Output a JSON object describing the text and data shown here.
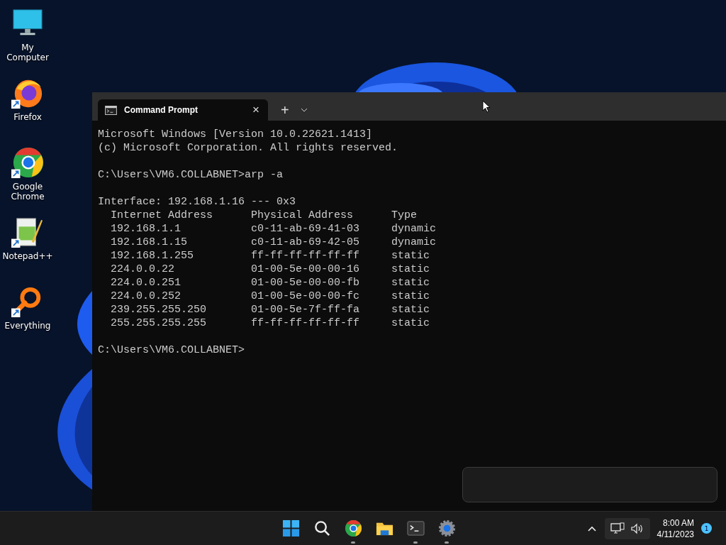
{
  "desktop_icons": [
    {
      "kind": "computer",
      "label": "My Computer",
      "shortcut": false
    },
    {
      "kind": "firefox",
      "label": "Firefox",
      "shortcut": true
    },
    {
      "kind": "chrome",
      "label": "Google Chrome",
      "shortcut": true
    },
    {
      "kind": "notepad",
      "label": "Notepad++",
      "shortcut": true
    },
    {
      "kind": "everything",
      "label": "Everything",
      "shortcut": true
    }
  ],
  "terminal": {
    "tab": {
      "title": "Command Prompt",
      "close": "×"
    },
    "new_tab": "+",
    "output": [
      [
        "Microsoft Windows [Version 10.0.22621.1413]",
        "(c) Microsoft Corporation. All rights reserved."
      ],
      [
        "C:\\Users\\VM6.COLLABNET>arp -a"
      ],
      [
        "Interface: 192.168.1.16 --- 0x3",
        "  Internet Address      Physical Address      Type",
        "  192.168.1.1           c0-11-ab-69-41-03     dynamic",
        "  192.168.1.15          c0-11-ab-69-42-05     dynamic",
        "  192.168.1.255         ff-ff-ff-ff-ff-ff     static",
        "  224.0.0.22            01-00-5e-00-00-16     static",
        "  224.0.0.251           01-00-5e-00-00-fb     static",
        "  224.0.0.252           01-00-5e-00-00-fc     static",
        "  239.255.255.250       01-00-5e-7f-ff-fa     static",
        "  255.255.255.255       ff-ff-ff-ff-ff-ff     static"
      ],
      [
        "C:\\Users\\VM6.COLLABNET>"
      ]
    ]
  },
  "taskbar": {
    "apps": [
      {
        "kind": "start",
        "running": false
      },
      {
        "kind": "search",
        "running": false
      },
      {
        "kind": "chrome",
        "running": true
      },
      {
        "kind": "files",
        "running": false
      },
      {
        "kind": "terminal",
        "running": true
      },
      {
        "kind": "settings",
        "running": true
      }
    ],
    "time": "8:00 AM",
    "date": "4/11/2023",
    "notification_count": "1"
  }
}
